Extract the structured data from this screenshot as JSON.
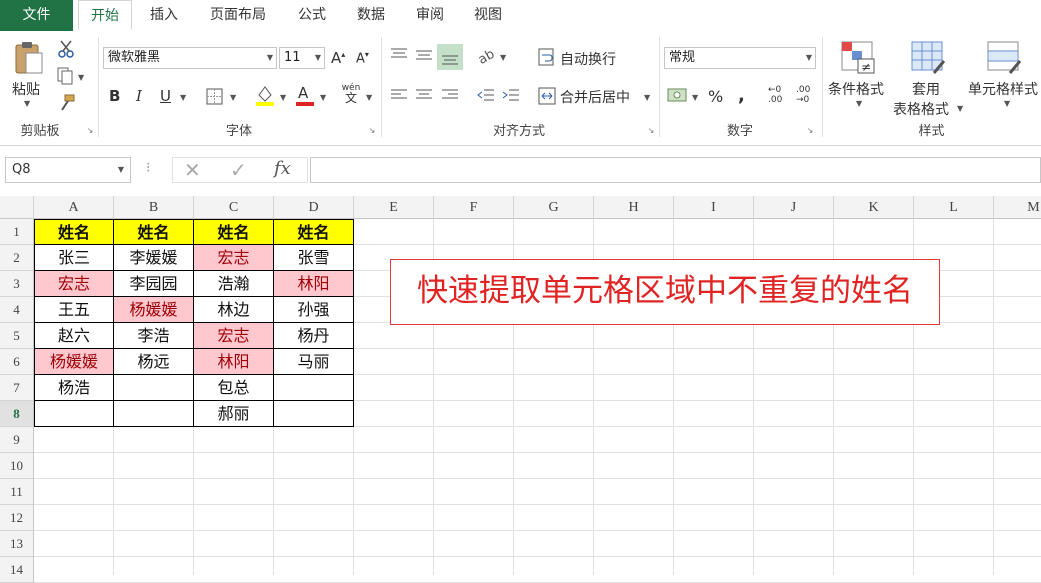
{
  "tabs": [
    "文件",
    "开始",
    "插入",
    "页面布局",
    "公式",
    "数据",
    "审阅",
    "视图"
  ],
  "clipboard": {
    "paste": "粘贴",
    "group": "剪贴板"
  },
  "font": {
    "name": "微软雅黑",
    "size": "11",
    "group": "字体",
    "wen": "wén"
  },
  "alignment": {
    "wrap": "自动换行",
    "merge": "合并后居中",
    "group": "对齐方式"
  },
  "number": {
    "format": "常规",
    "group": "数字",
    "percent": "%",
    "comma": ",",
    "inc": ".00",
    "dec": "→0"
  },
  "styles": {
    "cond": "条件格式",
    "table1": "套用",
    "table2": "表格格式",
    "cell": "单元格样式",
    "group": "样式"
  },
  "formula_bar": {
    "name_box": "Q8",
    "fx": "fx",
    "value": ""
  },
  "columns": [
    "A",
    "B",
    "C",
    "D",
    "E",
    "F",
    "G",
    "H",
    "I",
    "J",
    "K",
    "L",
    "M"
  ],
  "rows": [
    "1",
    "2",
    "3",
    "4",
    "5",
    "6",
    "7",
    "8",
    "9",
    "10",
    "11",
    "12",
    "13",
    "14"
  ],
  "selected_row": "8",
  "table": [
    [
      "姓名",
      "姓名",
      "姓名",
      "姓名"
    ],
    [
      "张三",
      "李媛媛",
      "宏志",
      "张雪"
    ],
    [
      "宏志",
      "李园园",
      "浩瀚",
      "林阳"
    ],
    [
      "王五",
      "杨媛媛",
      "林边",
      "孙强"
    ],
    [
      "赵六",
      "李浩",
      "宏志",
      "杨丹"
    ],
    [
      "杨媛媛",
      "杨远",
      "林阳",
      "马丽"
    ],
    [
      "杨浩",
      "",
      "包总",
      ""
    ],
    [
      "",
      "",
      "郝丽",
      ""
    ]
  ],
  "duplicates": [
    [
      1,
      2
    ],
    [
      2,
      0
    ],
    [
      2,
      3
    ],
    [
      3,
      1
    ],
    [
      4,
      2
    ],
    [
      5,
      0
    ],
    [
      5,
      2
    ]
  ],
  "colors": {
    "header_fill": "#ffff00",
    "dup_fill": "#ffc7ce",
    "dup_text": "#9c0006",
    "accent": "#217346",
    "banner": "#e02424"
  },
  "banner": "快速提取单元格区域中不重复的姓名"
}
